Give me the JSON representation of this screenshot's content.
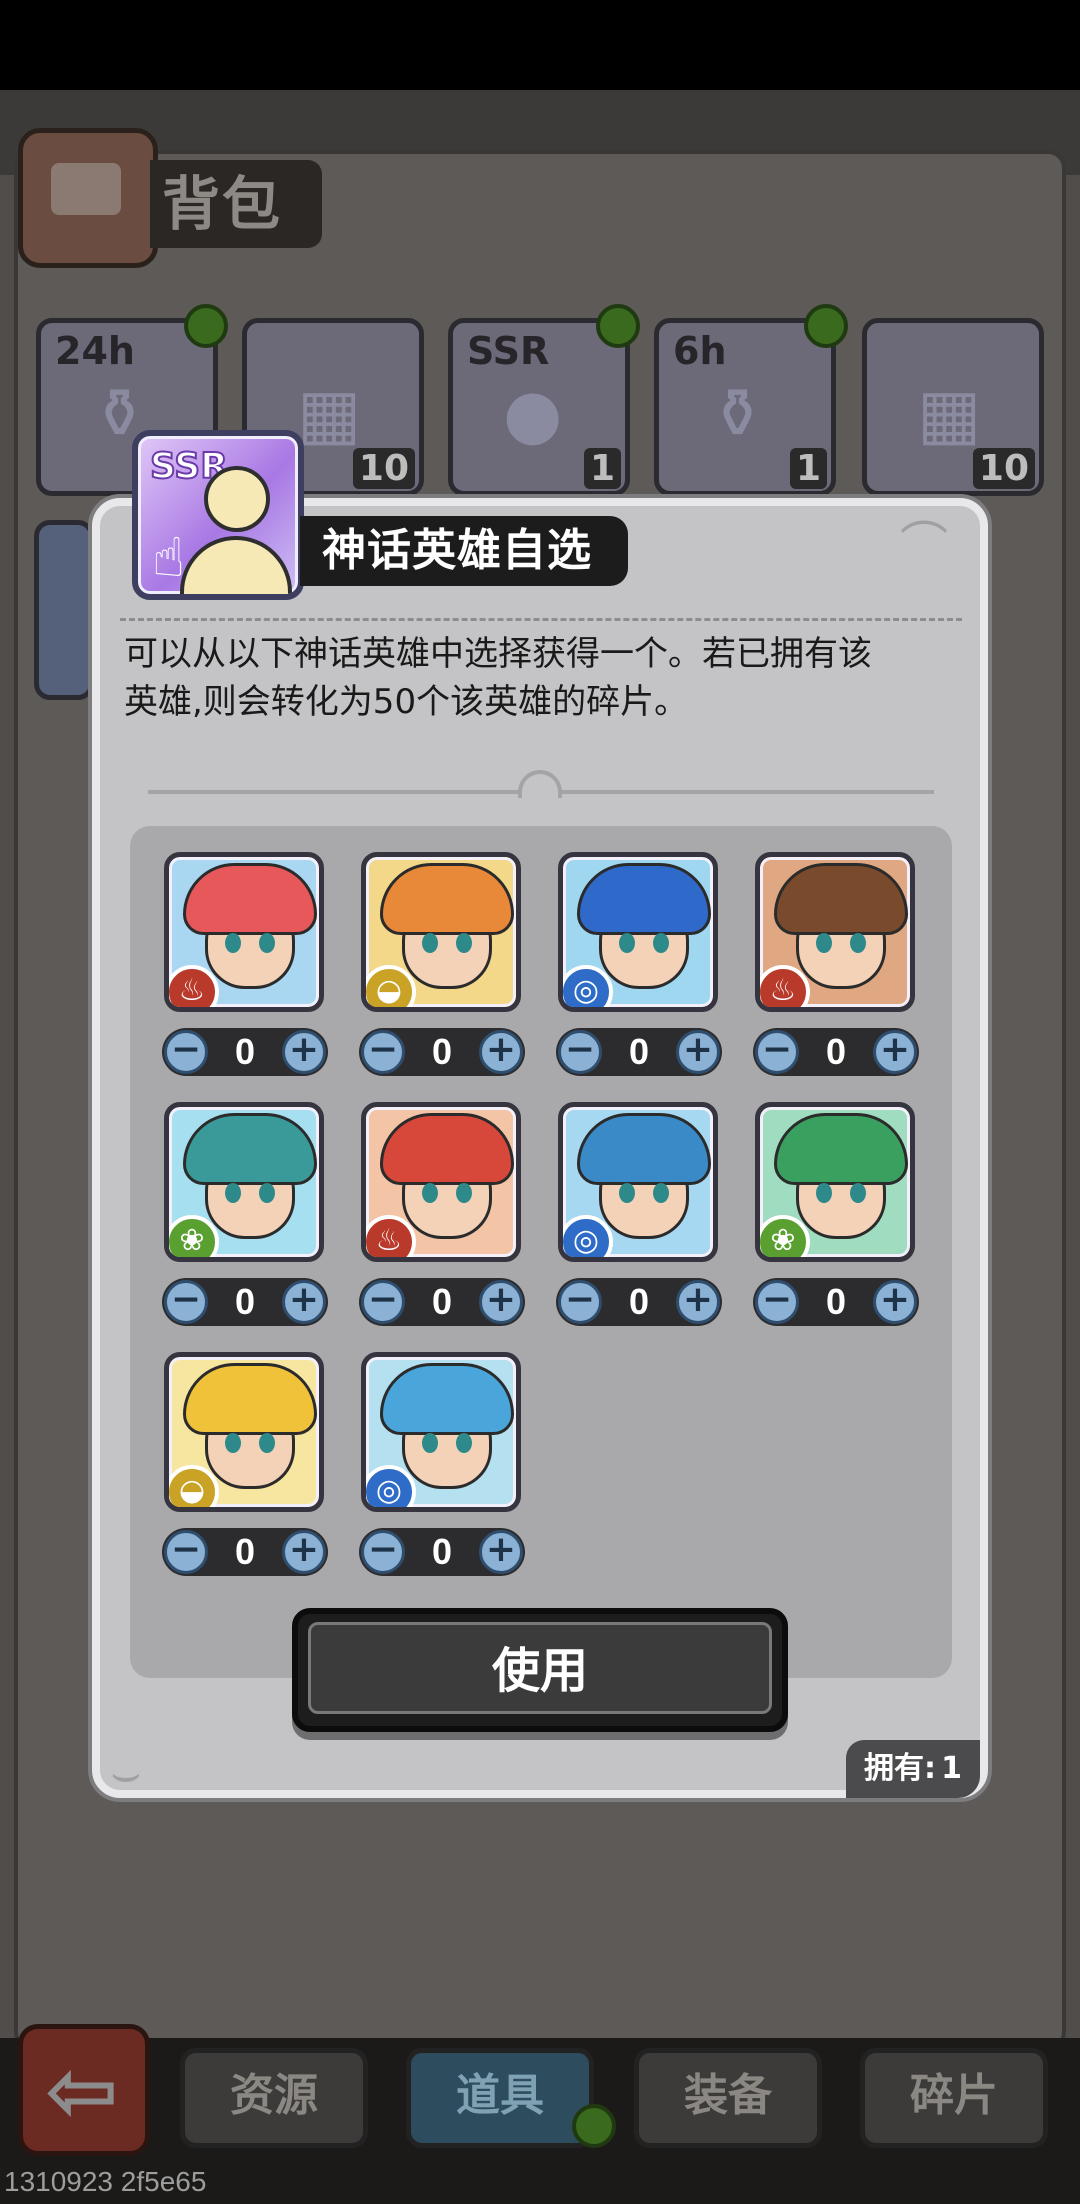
{
  "background": {
    "title": "背包",
    "slots": [
      {
        "tag": "24h",
        "count": ""
      },
      {
        "tag": "",
        "count": "10"
      },
      {
        "tag": "SSR",
        "count": "1"
      },
      {
        "tag": "6h",
        "count": "1"
      },
      {
        "tag": "",
        "count": "10"
      }
    ],
    "tabs": [
      "资源",
      "道具",
      "装备",
      "碎片"
    ],
    "active_tab": "道具",
    "version": "1310923 2f5e65"
  },
  "modal": {
    "item_badge": "SSR",
    "title": "神话英雄自选",
    "description_line1": "可以从以下神话英雄中选择获得一个。若已拥有该",
    "description_line2": "英雄,则会转化为50个该英雄的碎片。",
    "heroes": [
      {
        "element": "fire",
        "qty": "0",
        "colors": {
          "hair": "#e6585a",
          "bg": "#a9d7f2"
        }
      },
      {
        "element": "earth",
        "qty": "0",
        "colors": {
          "hair": "#e8893a",
          "bg": "#f3d88a"
        }
      },
      {
        "element": "water",
        "qty": "0",
        "colors": {
          "hair": "#2f69c9",
          "bg": "#9fd6f0"
        }
      },
      {
        "element": "fire",
        "qty": "0",
        "colors": {
          "hair": "#7a4a2c",
          "bg": "#e0a882"
        }
      },
      {
        "element": "wind",
        "qty": "0",
        "colors": {
          "hair": "#3a9a9a",
          "bg": "#a6dff0"
        }
      },
      {
        "element": "fire",
        "qty": "0",
        "colors": {
          "hair": "#d8483a",
          "bg": "#f3c4a6"
        }
      },
      {
        "element": "water",
        "qty": "0",
        "colors": {
          "hair": "#3a8ac8",
          "bg": "#a6d8f2"
        }
      },
      {
        "element": "wind",
        "qty": "0",
        "colors": {
          "hair": "#3aa060",
          "bg": "#9fdcc0"
        }
      },
      {
        "element": "earth",
        "qty": "0",
        "colors": {
          "hair": "#f0c23a",
          "bg": "#f7e6a0"
        }
      },
      {
        "element": "water",
        "qty": "0",
        "colors": {
          "hair": "#4aa6da",
          "bg": "#b4e0f0"
        }
      }
    ],
    "use_button": "使用",
    "owned_label": "拥有:",
    "owned_count": "1"
  },
  "icons": {
    "minus": "minus-icon",
    "plus": "plus-icon",
    "back": "back-arrow-icon"
  }
}
